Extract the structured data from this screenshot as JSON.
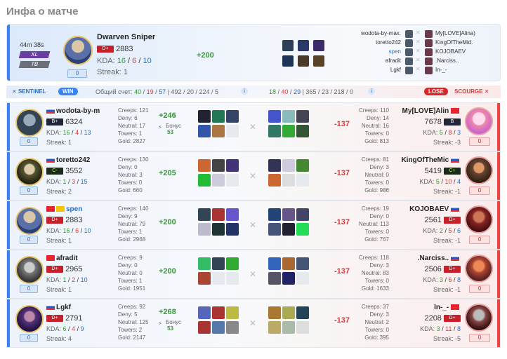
{
  "page_title": "Инфа о матче",
  "match": {
    "duration": "44m 38s",
    "badge1": "XL",
    "badge2": "TB",
    "hero": "Dwarven Sniper",
    "rank": "D+",
    "rating": "2883",
    "kda_k": "16",
    "kda_d": "6",
    "kda_a": "10",
    "kda_label": "KDA:",
    "streak": "Streak: 1",
    "gain": "+200",
    "zero": "0",
    "players_left": [
      "wodota-by-max.",
      "toretto242",
      "spen",
      "afradit",
      "Lgkf"
    ],
    "players_right": [
      "My[LOVE]Alina)",
      "KingOfTheMid.",
      "KOJOBAEV",
      ".Narciss..",
      "In-_-"
    ]
  },
  "score": {
    "sentinel": "SENTINEL",
    "win": "WIN",
    "label": "Общий счет:",
    "l1": "40",
    "l2": "19",
    "l3": "57",
    "l4": "492 / 20 / 224 / 5",
    "r1": "18",
    "r2": "40",
    "r3": "29",
    "r4": "365 / 23 / 218 / 0",
    "lose": "LOSE",
    "scourge": "SCOURGE"
  },
  "rows": [
    {
      "lname": "wodota-by-m",
      "lrank": "B+",
      "lrating": "6324",
      "lk": "16",
      "ld": "4",
      "la": "13",
      "lstreak": "Streak: 1",
      "lcreeps": "Creeps: 121",
      "ldeny": "Deny: 6",
      "lneutral": "Neutral: 17",
      "ltowers": "Towers: 1",
      "lgold": "Gold: 2827",
      "lgain": "+246",
      "bonus": "Бонус",
      "bonusv": "53",
      "rcreeps": "Creeps: 110",
      "rdeny": "Deny: 14",
      "rneutral": "Neutral: 16",
      "rtowers": "Towers: 0",
      "rgold": "Gold: 813",
      "rloss": "-137",
      "rname": "My[LOVE]Alin",
      "rrank": "B",
      "rrating": "7678",
      "rk": "5",
      "rd": "8",
      "ra": "3",
      "rstreak": "Streak: -3"
    },
    {
      "lname": "toretto242",
      "lrank": "C-",
      "lrating": "3552",
      "lk": "1",
      "ld": "3",
      "la": "15",
      "lstreak": "Streak: 2",
      "lcreeps": "Creeps: 130",
      "ldeny": "Deny: 0",
      "lneutral": "Neutral: 3",
      "ltowers": "Towers: 0",
      "lgold": "Gold: 660",
      "lgain": "+205",
      "bonus": "",
      "bonusv": "",
      "rcreeps": "Creeps: 81",
      "rdeny": "Deny: 3",
      "rneutral": "Neutral: 0",
      "rtowers": "Towers: 0",
      "rgold": "Gold: 986",
      "rloss": "-137",
      "rname": "KingOfTheMic",
      "rrank": "C+",
      "rrating": "5419",
      "rk": "5",
      "rd": "10",
      "ra": "4",
      "rstreak": "Streak: -1"
    },
    {
      "lname": "spen",
      "lrank": "D+",
      "lrating": "2883",
      "lk": "16",
      "ld": "6",
      "la": "10",
      "lstreak": "Streak: 1",
      "lcreeps": "Creeps: 140",
      "ldeny": "Deny: 9",
      "lneutral": "Neutral: 79",
      "ltowers": "Towers: 1",
      "lgold": "Gold: 2968",
      "lgain": "+200",
      "bonus": "",
      "bonusv": "",
      "rcreeps": "Creeps: 19",
      "rdeny": "Deny: 0",
      "rneutral": "Neutral: 113",
      "rtowers": "Towers: 0",
      "rgold": "Gold: 767",
      "rloss": "-137",
      "rname": "KOJOBAEV",
      "rrank": "D+",
      "rrating": "2561",
      "rk": "2",
      "rd": "5",
      "ra": "6",
      "rstreak": "Streak: -1"
    },
    {
      "lname": "afradit",
      "lrank": "D+",
      "lrating": "2965",
      "lk": "1",
      "ld": "2",
      "la": "10",
      "lstreak": "Streak: 1",
      "lcreeps": "Creeps: 9",
      "ldeny": "Deny: 0",
      "lneutral": "Neutral: 0",
      "ltowers": "Towers: 1",
      "lgold": "Gold: 1951",
      "lgain": "+200",
      "bonus": "",
      "bonusv": "",
      "rcreeps": "Creeps: 118",
      "rdeny": "Deny: 3",
      "rneutral": "Neutral: 83",
      "rtowers": "Towers: 0",
      "rgold": "Gold: 1633",
      "rloss": "-137",
      "rname": ".Narciss..",
      "rrank": "D+",
      "rrating": "2506",
      "rk": "3",
      "rd": "6",
      "ra": "8",
      "rstreak": "Streak: -1"
    },
    {
      "lname": "Lgkf",
      "lrank": "D+",
      "lrating": "2791",
      "lk": "6",
      "ld": "4",
      "la": "9",
      "lstreak": "Streak: 4",
      "lcreeps": "Creeps: 92",
      "ldeny": "Deny: 5",
      "lneutral": "Neutral: 125",
      "ltowers": "Towers: 2",
      "lgold": "Gold: 2147",
      "lgain": "+268",
      "bonus": "Бонус",
      "bonusv": "53",
      "rcreeps": "Creeps: 37",
      "rdeny": "Deny: 3",
      "rneutral": "Neutral: 2",
      "rtowers": "Towers: 0",
      "rgold": "Gold: 395",
      "rloss": "-137",
      "rname": "In-_-",
      "rrank": "D+",
      "rrating": "2208",
      "rk": "3",
      "rd": "11",
      "ra": "8",
      "rstreak": "Streak: -5"
    }
  ],
  "colors": {
    "sentinel": "#3b82f6",
    "scourge": "#ef4444",
    "win": "#3b82f6",
    "lose": "#dc2626",
    "gain": "#2e9e2e",
    "loss": "#d63b3b"
  }
}
